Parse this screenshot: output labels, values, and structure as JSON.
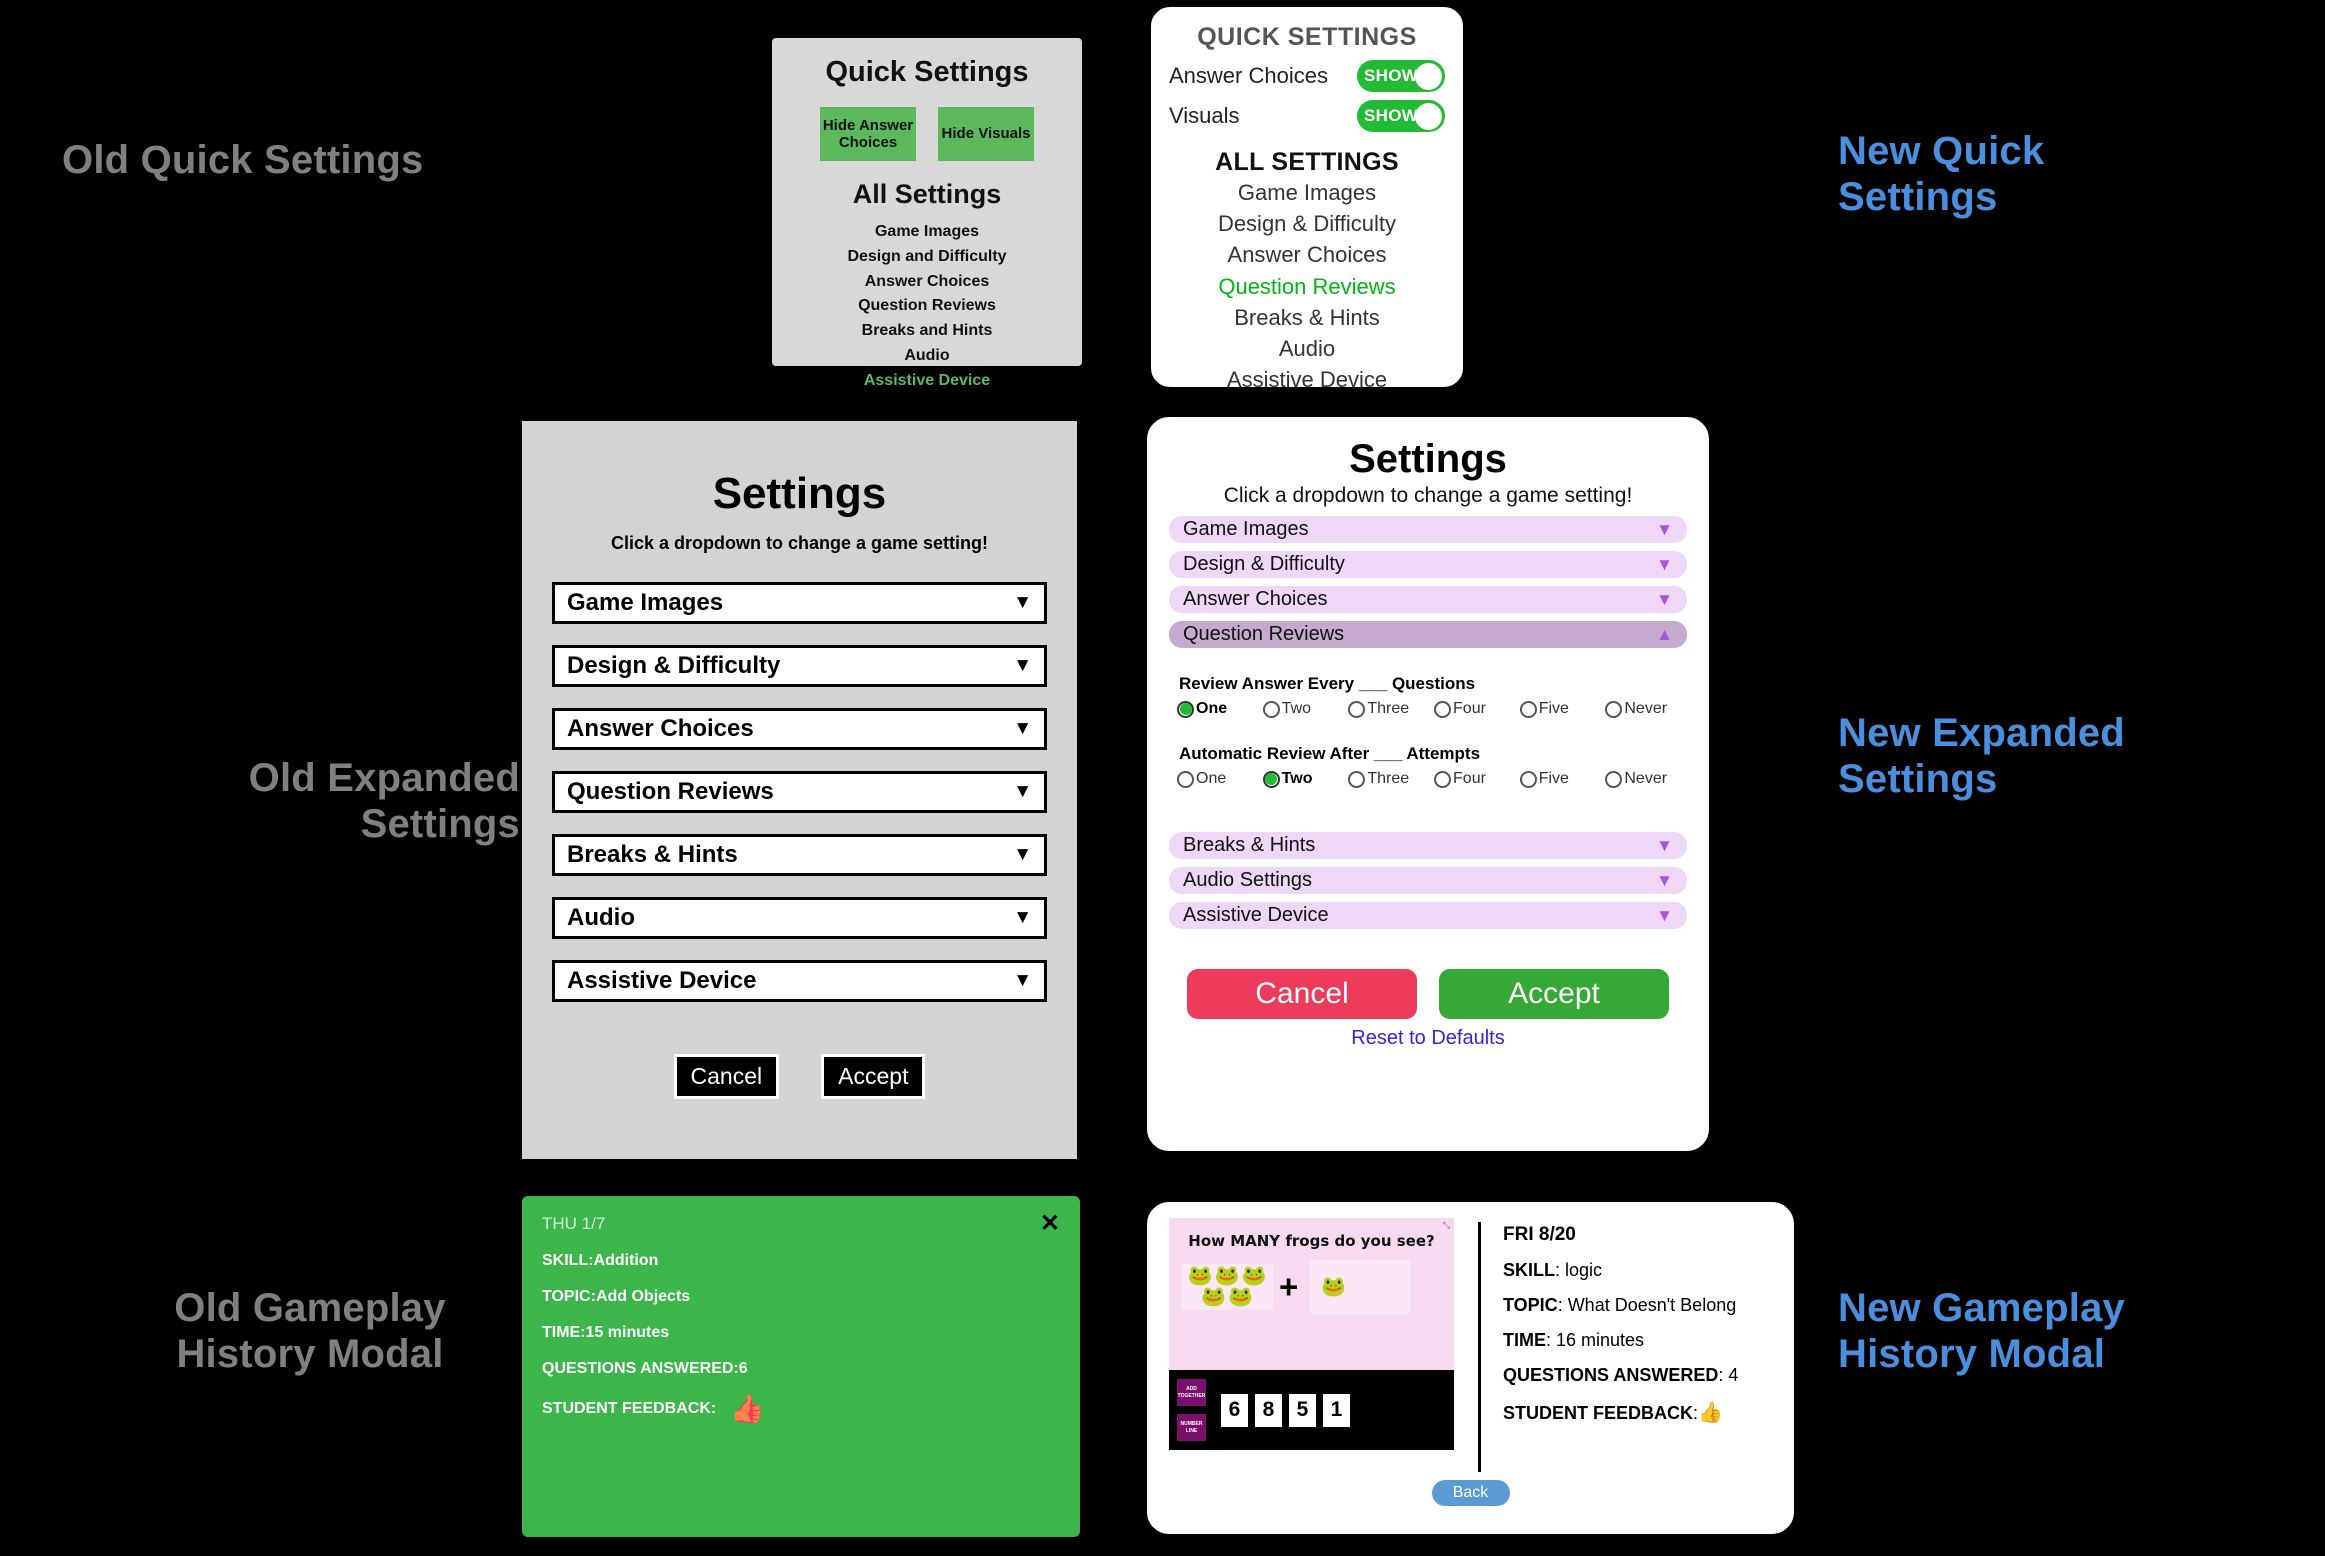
{
  "labels": {
    "old_quick": "Old Quick Settings",
    "old_expanded": "Old Expanded\nSettings",
    "old_history": "Old Gameplay\nHistory Modal",
    "new_quick": "New Quick\nSettings",
    "new_expanded": "New Expanded\nSettings",
    "new_history": "New Gameplay\nHistory Modal"
  },
  "colors": {
    "old_label": "#808080",
    "new_label": "#4a8fdd",
    "green_accent": "#22bb33",
    "old_panel_bg": "#d3d3d3",
    "purple_dropdown": "#eed7f7",
    "purple_open": "#c6a9cf",
    "cancel_red": "#ef3b5b",
    "accept_green": "#36a836",
    "reset_link": "#3a1fe0",
    "back_blue": "#5b9bd5",
    "old_modal_green": "#3cb54a"
  },
  "old_quick": {
    "title": "Quick Settings",
    "buttons": [
      {
        "label": "Hide Answer Choices"
      },
      {
        "label": "Hide Visuals"
      }
    ],
    "all_settings_title": "All Settings",
    "items": [
      {
        "label": "Game Images",
        "active": false
      },
      {
        "label": "Design and Difficulty",
        "active": false
      },
      {
        "label": "Answer Choices",
        "active": false
      },
      {
        "label": "Question Reviews",
        "active": false
      },
      {
        "label": "Breaks and Hints",
        "active": false
      },
      {
        "label": "Audio",
        "active": false
      },
      {
        "label": "Assistive Device",
        "active": true
      }
    ]
  },
  "new_quick": {
    "title": "QUICK SETTINGS",
    "toggles": [
      {
        "label": "Answer Choices",
        "state": "SHOW"
      },
      {
        "label": "Visuals",
        "state": "SHOW"
      }
    ],
    "all_settings_title": "ALL SETTINGS",
    "items": [
      {
        "label": "Game Images",
        "active": false
      },
      {
        "label": "Design & Difficulty",
        "active": false
      },
      {
        "label": "Answer Choices",
        "active": false
      },
      {
        "label": "Question Reviews",
        "active": true
      },
      {
        "label": "Breaks & Hints",
        "active": false
      },
      {
        "label": "Audio",
        "active": false
      },
      {
        "label": "Assistive Device",
        "active": false
      }
    ]
  },
  "old_expanded": {
    "title": "Settings",
    "subtitle": "Click a dropdown to change a game setting!",
    "dropdowns": [
      {
        "label": "Game Images",
        "caret": "▼"
      },
      {
        "label": "Design & Difficulty",
        "caret": "▼"
      },
      {
        "label": "Answer Choices",
        "caret": "▼"
      },
      {
        "label": "Question Reviews",
        "caret": "▼"
      },
      {
        "label": "Breaks & Hints",
        "caret": "▼"
      },
      {
        "label": "Audio",
        "caret": "▼"
      },
      {
        "label": "Assistive Device",
        "caret": "▼"
      }
    ],
    "cancel_label": "Cancel",
    "accept_label": "Accept"
  },
  "new_expanded": {
    "title": "Settings",
    "subtitle": "Click a dropdown to change a game setting!",
    "dropdowns_top": [
      {
        "label": "Game Images",
        "caret": "▼",
        "open": false
      },
      {
        "label": "Design & Difficulty",
        "caret": "▼",
        "open": false
      },
      {
        "label": "Answer Choices",
        "caret": "▼",
        "open": false
      },
      {
        "label": "Question Reviews",
        "caret": "▲",
        "open": true
      }
    ],
    "radio_groups": [
      {
        "title": "Review Answer Every ___ Questions",
        "options": [
          "One",
          "Two",
          "Three",
          "Four",
          "Five",
          "Never"
        ],
        "selected": "One"
      },
      {
        "title": "Automatic Review After ___ Attempts",
        "options": [
          "One",
          "Two",
          "Three",
          "Four",
          "Five",
          "Never"
        ],
        "selected": "Two"
      }
    ],
    "dropdowns_bottom": [
      {
        "label": "Breaks & Hints",
        "caret": "▼",
        "open": false
      },
      {
        "label": "Audio Settings",
        "caret": "▼",
        "open": false
      },
      {
        "label": "Assistive Device",
        "caret": "▼",
        "open": false
      }
    ],
    "cancel_label": "Cancel",
    "accept_label": "Accept",
    "reset_label": "Reset to Defaults"
  },
  "old_history": {
    "date": "THU 1/7",
    "close_icon": "✕",
    "rows": [
      {
        "key": "SKILL:",
        "value": "Addition"
      },
      {
        "key": "TOPIC:",
        "value": "Add Objects"
      },
      {
        "key": "TIME:",
        "value": "15 minutes"
      },
      {
        "key": "QUESTIONS ANSWERED:",
        "value": "6"
      },
      {
        "key": "STUDENT FEEDBACK:",
        "value": ""
      }
    ],
    "feedback_icon": "👍"
  },
  "new_history": {
    "game": {
      "question": "How MANY  frogs  do you see?",
      "resize_icon": "⤡",
      "left_group_frogs": 5,
      "right_group_frogs": 1,
      "operator": "+",
      "frog_icon": "🐸",
      "tools": [
        "ADD TOGETHER",
        "NUMBER LINE"
      ],
      "answer_tiles": [
        "6",
        "8",
        "5",
        "1"
      ]
    },
    "date": "FRI 8/20",
    "rows": [
      {
        "key": "SKILL",
        "value": ": logic"
      },
      {
        "key": "TOPIC",
        "value": ": What Doesn't Belong"
      },
      {
        "key": "TIME",
        "value": ": 16 minutes"
      },
      {
        "key": "QUESTIONS ANSWERED",
        "value": ": 4"
      },
      {
        "key": "STUDENT FEEDBACK",
        "value": ":"
      }
    ],
    "feedback_icon": "👍",
    "back_label": "Back"
  }
}
